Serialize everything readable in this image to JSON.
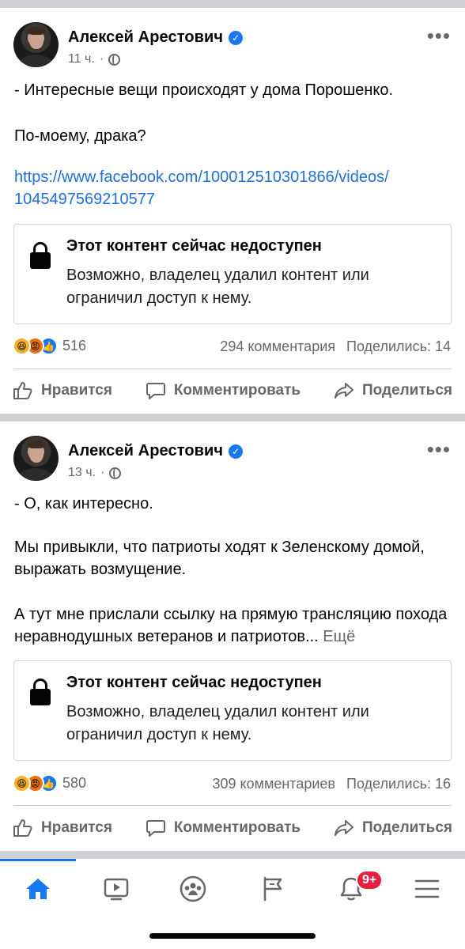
{
  "posts": [
    {
      "author": "Алексей Арестович",
      "time": "11 ч.",
      "text_lines": [
        "- Интересные вещи происходят у дома Порошенко."
      ],
      "text_line2": "По-моему, драка?",
      "link_line1": "https://www.facebook.com/100012510301866/videos/",
      "link_line2": "1045497569210577",
      "unavailable_title": "Этот контент сейчас недоступен",
      "unavailable_desc": "Возможно, владелец удалил контент или ограничил доступ к нему.",
      "reaction_count": "516",
      "comments": "294 комментария",
      "shares": "Поделились: 14"
    },
    {
      "author": "Алексей Арестович",
      "time": "13 ч.",
      "line1": "- О, как интересно.",
      "para2": "Мы привыкли, что патриоты ходят к Зеленскому домой, выражать возмущение.",
      "para3": "А тут мне прислали ссылку на прямую трансляцию похода неравнодушных ветеранов и патриотов...",
      "see_more": "Ещё",
      "unavailable_title": "Этот контент сейчас недоступен",
      "unavailable_desc": "Возможно, владелец удалил контент или ограничил доступ к нему.",
      "reaction_count": "580",
      "comments": "309 комментариев",
      "shares": "Поделились: 16"
    }
  ],
  "actions": {
    "like": "Нравится",
    "comment": "Комментировать",
    "share": "Поделиться"
  },
  "more_icon": "•••",
  "tabbar": {
    "notifications_badge": "9+",
    "icons": [
      "home-icon",
      "video-icon",
      "groups-icon",
      "pages-flag-icon",
      "bell-icon",
      "menu-icon"
    ]
  },
  "colors": {
    "accent": "#1877f2",
    "link": "#216fdb",
    "secondary_text": "#65676b",
    "badge": "#e41e3f",
    "separator": "#ced0d4"
  }
}
